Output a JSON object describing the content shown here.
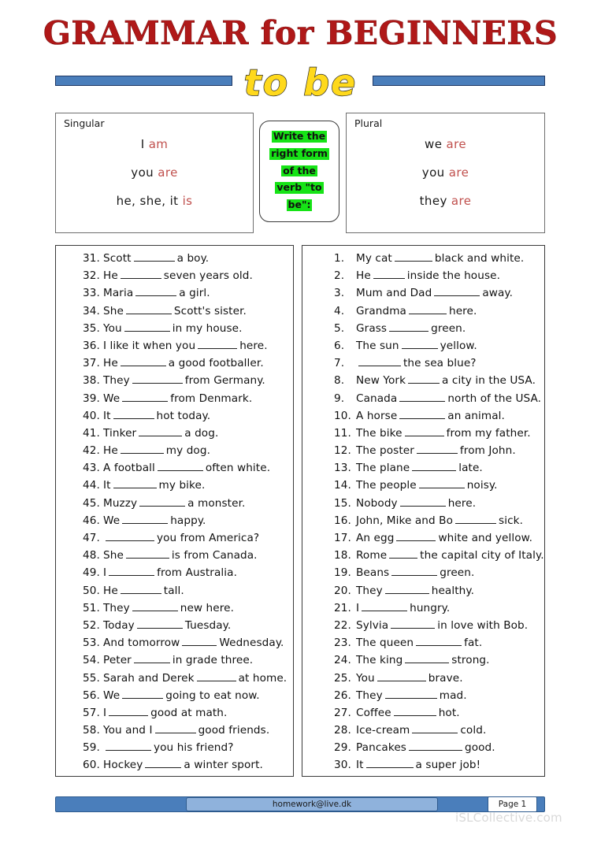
{
  "header": {
    "title": "GRAMMAR for BEGINNERS",
    "subtitle": "to be",
    "title_color": "#b01818",
    "subtitle_color": "#ffd91c",
    "bar_color": "#4a7ebb"
  },
  "instruction": {
    "lines": [
      "Write the",
      "right form",
      "of the",
      "verb \"to",
      "be\":"
    ],
    "highlight_color": "#16e316"
  },
  "conjugation": {
    "verb_color": "#c0504d",
    "singular": {
      "label": "Singular",
      "rows": [
        {
          "subject": "I",
          "verb": "am"
        },
        {
          "subject": "you",
          "verb": "are"
        },
        {
          "subject": "he, she, it",
          "verb": "is"
        }
      ]
    },
    "plural": {
      "label": "Plural",
      "rows": [
        {
          "subject": "we",
          "verb": "are"
        },
        {
          "subject": "you",
          "verb": "are"
        },
        {
          "subject": "they",
          "verb": "are"
        }
      ]
    }
  },
  "exercises": {
    "left_column": [
      {
        "num": "31.",
        "before": "Scott",
        "blank": 52,
        "after": "a boy."
      },
      {
        "num": "32.",
        "before": "He",
        "blank": 52,
        "after": "seven years old."
      },
      {
        "num": "33.",
        "before": "Maria",
        "blank": 52,
        "after": "a girl."
      },
      {
        "num": "34.",
        "before": "She",
        "blank": 58,
        "after": "Scott's sister."
      },
      {
        "num": "35.",
        "before": "You",
        "blank": 58,
        "after": "in my house."
      },
      {
        "num": "36.",
        "before": "I like it when you",
        "blank": 50,
        "after": "here."
      },
      {
        "num": "37.",
        "before": "He",
        "blank": 58,
        "after": "a good footballer."
      },
      {
        "num": "38.",
        "before": "They",
        "blank": 64,
        "after": "from Germany."
      },
      {
        "num": "39.",
        "before": "We",
        "blank": 58,
        "after": "from Denmark."
      },
      {
        "num": "40.",
        "before": "It",
        "blank": 52,
        "after": "hot today."
      },
      {
        "num": "41.",
        "before": "Tinker",
        "blank": 55,
        "after": "a dog."
      },
      {
        "num": "42.",
        "before": "He",
        "blank": 55,
        "after": "my dog."
      },
      {
        "num": "43.",
        "before": "A football",
        "blank": 58,
        "after": "often white."
      },
      {
        "num": "44.",
        "before": "It",
        "blank": 55,
        "after": "my bike."
      },
      {
        "num": "45.",
        "before": "Muzzy",
        "blank": 58,
        "after": "a monster."
      },
      {
        "num": "46.",
        "before": "We",
        "blank": 58,
        "after": "happy."
      },
      {
        "num": "47.",
        "before": "",
        "blank": 62,
        "after": "you from America?"
      },
      {
        "num": "48.",
        "before": "She",
        "blank": 55,
        "after": "is from Canada."
      },
      {
        "num": "49.",
        "before": "I",
        "blank": 58,
        "after": "from Australia."
      },
      {
        "num": "50.",
        "before": "He",
        "blank": 52,
        "after": "tall."
      },
      {
        "num": "51.",
        "before": "They",
        "blank": 58,
        "after": "new here."
      },
      {
        "num": "52.",
        "before": "Today",
        "blank": 58,
        "after": "Tuesday."
      },
      {
        "num": "53.",
        "before": "And tomorrow",
        "blank": 44,
        "after": "Wednesday."
      },
      {
        "num": "54.",
        "before": "Peter",
        "blank": 46,
        "after": "in grade three."
      },
      {
        "num": "55.",
        "before": "Sarah and Derek",
        "blank": 50,
        "after": "at home."
      },
      {
        "num": "56.",
        "before": "We",
        "blank": 52,
        "after": "going to eat now."
      },
      {
        "num": "57.",
        "before": "I",
        "blank": 50,
        "after": "good at math."
      },
      {
        "num": "58.",
        "before": "You and I",
        "blank": 52,
        "after": "good friends."
      },
      {
        "num": "59.",
        "before": "",
        "blank": 58,
        "after": "you his friend?"
      },
      {
        "num": "60.",
        "before": "Hockey",
        "blank": 46,
        "after": "a winter sport."
      }
    ],
    "right_column": [
      {
        "num": "1.",
        "before": "My cat",
        "blank": 48,
        "after": "black and white."
      },
      {
        "num": "2.",
        "before": "He",
        "blank": 40,
        "after": "inside the house."
      },
      {
        "num": "3.",
        "before": "Mum and Dad",
        "blank": 58,
        "after": "away."
      },
      {
        "num": "4.",
        "before": "Grandma",
        "blank": 48,
        "after": "here."
      },
      {
        "num": "5.",
        "before": "Grass",
        "blank": 50,
        "after": "green."
      },
      {
        "num": "6.",
        "before": "The sun",
        "blank": 46,
        "after": "yellow."
      },
      {
        "num": "7.",
        "before": "",
        "blank": 54,
        "after": "the sea blue?"
      },
      {
        "num": "8.",
        "before": "New York",
        "blank": 40,
        "after": "a city in the USA."
      },
      {
        "num": "9.",
        "before": "Canada",
        "blank": 58,
        "after": "north of the USA."
      },
      {
        "num": "10.",
        "before": "A horse",
        "blank": 58,
        "after": "an animal."
      },
      {
        "num": "11.",
        "before": "The bike",
        "blank": 50,
        "after": "from my father."
      },
      {
        "num": "12.",
        "before": "The poster",
        "blank": 52,
        "after": "from John."
      },
      {
        "num": "13.",
        "before": "The plane",
        "blank": 56,
        "after": "late."
      },
      {
        "num": "14.",
        "before": "The people",
        "blank": 58,
        "after": "noisy."
      },
      {
        "num": "15.",
        "before": "Nobody",
        "blank": 58,
        "after": "here."
      },
      {
        "num": "16.",
        "before": "John, Mike and Bo",
        "blank": 52,
        "after": "sick."
      },
      {
        "num": "17.",
        "before": "An egg",
        "blank": 50,
        "after": "white and yellow."
      },
      {
        "num": "18.",
        "before": "Rome",
        "blank": 36,
        "after": "the capital city of Italy."
      },
      {
        "num": "19.",
        "before": "Beans",
        "blank": 58,
        "after": "green."
      },
      {
        "num": "20.",
        "before": "They",
        "blank": 56,
        "after": "healthy."
      },
      {
        "num": "21.",
        "before": "I",
        "blank": 58,
        "after": "hungry."
      },
      {
        "num": "22.",
        "before": "Sylvia",
        "blank": 56,
        "after": "in love with Bob."
      },
      {
        "num": "23.",
        "before": "The queen",
        "blank": 58,
        "after": "fat."
      },
      {
        "num": "24.",
        "before": "The king",
        "blank": 56,
        "after": "strong."
      },
      {
        "num": "25.",
        "before": "You",
        "blank": 62,
        "after": "brave."
      },
      {
        "num": "26.",
        "before": "They",
        "blank": 66,
        "after": "mad."
      },
      {
        "num": "27.",
        "before": "Coffee",
        "blank": 54,
        "after": "hot."
      },
      {
        "num": "28.",
        "before": "Ice-cream",
        "blank": 58,
        "after": "cold."
      },
      {
        "num": "29.",
        "before": "Pancakes",
        "blank": 68,
        "after": "good."
      },
      {
        "num": "30.",
        "before": "It",
        "blank": 60,
        "after": "a super job!"
      }
    ]
  },
  "footer": {
    "email": "homework@live.dk",
    "page_label": "Page 1",
    "watermark": "iSLCollective.com"
  }
}
